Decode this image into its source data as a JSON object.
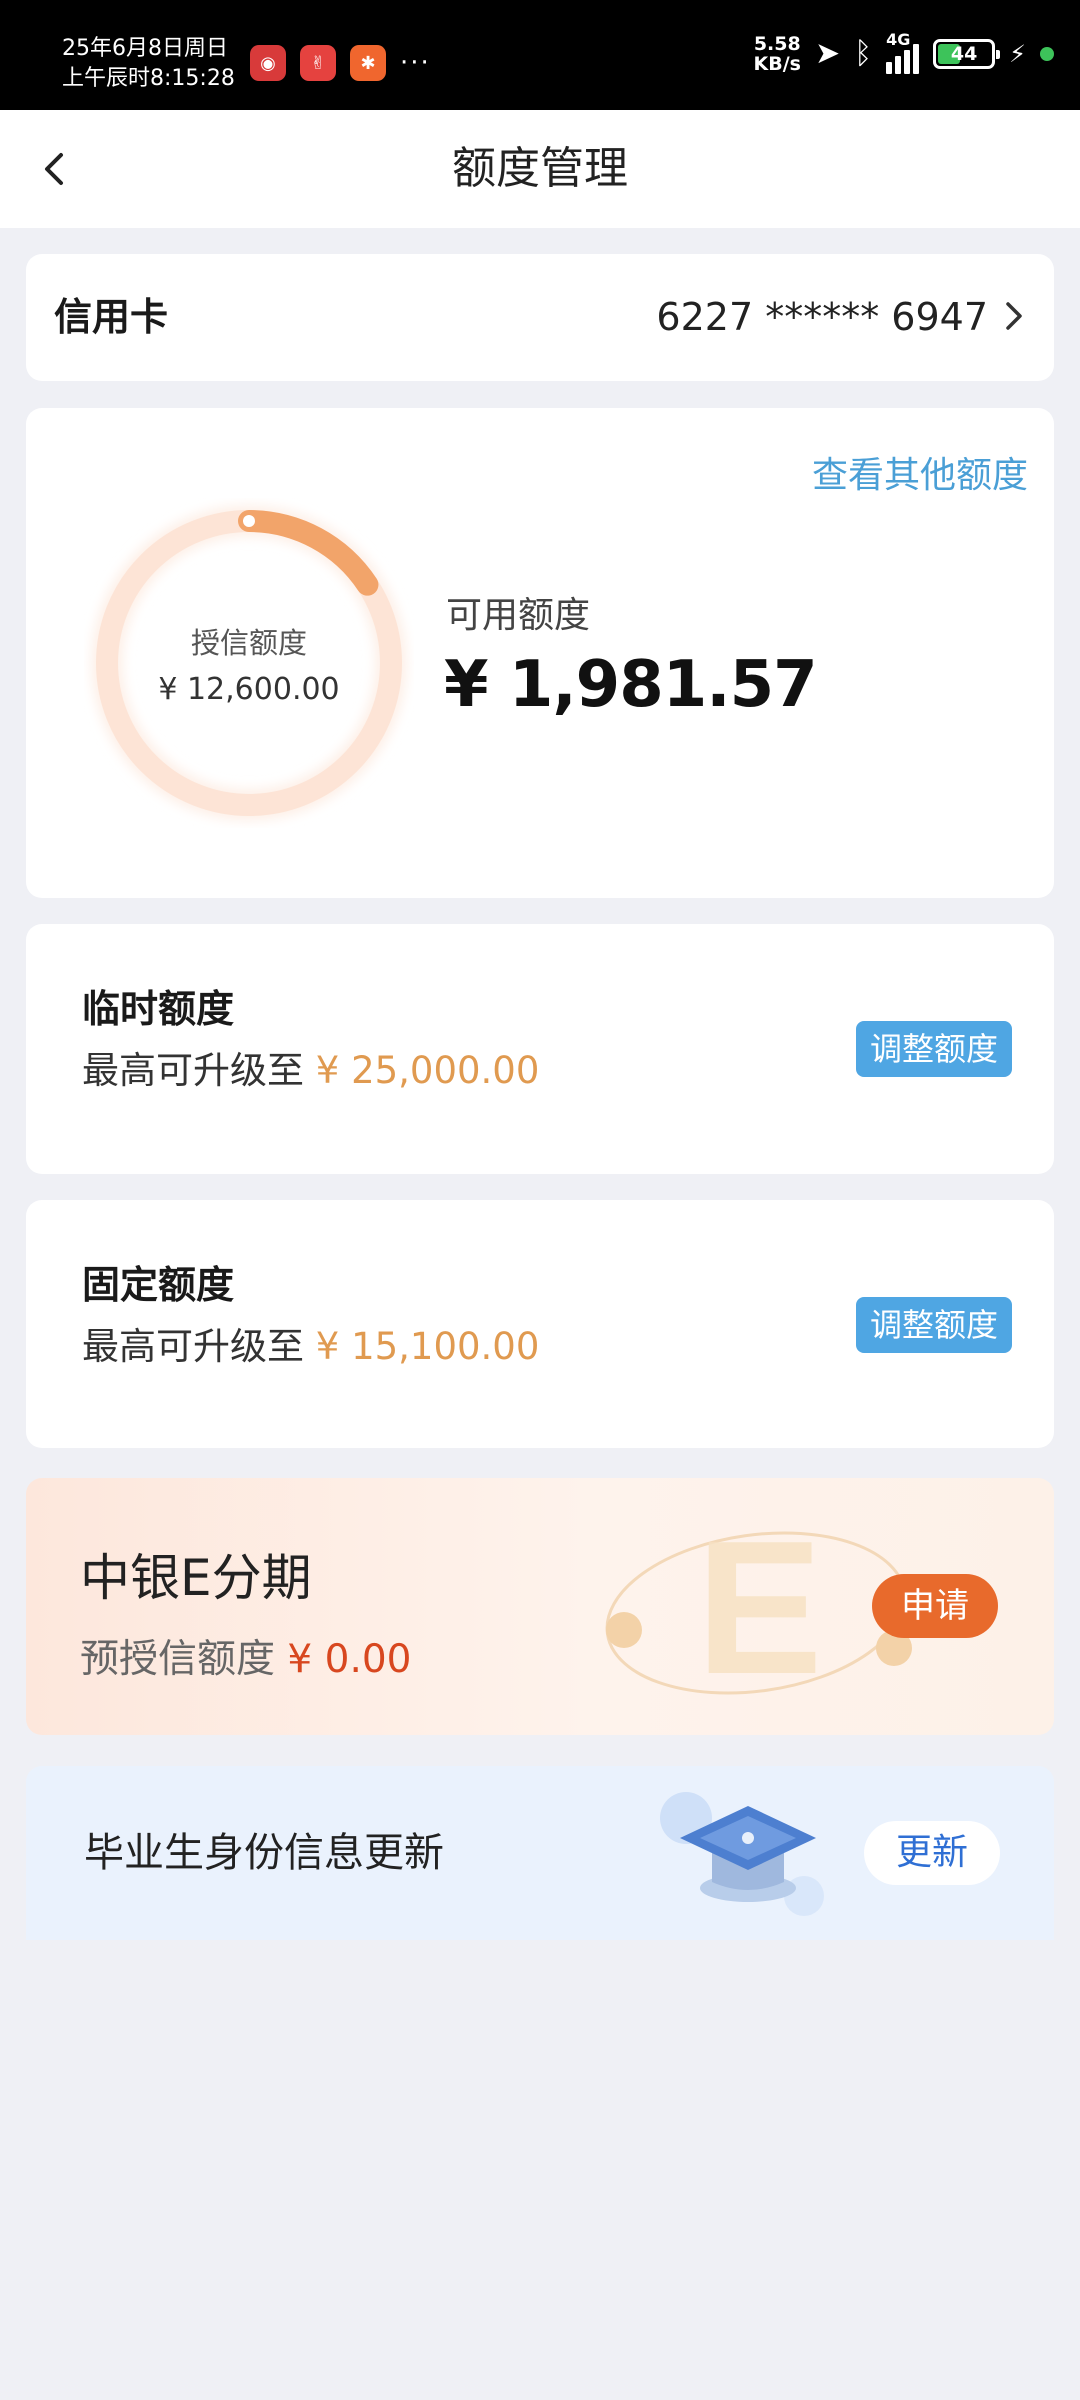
{
  "status_bar": {
    "date": "25年6月8日周日",
    "time": "上午辰时8:15:28",
    "more": "···",
    "speed_value": "5.58",
    "speed_unit": "KB/s",
    "network": "4G",
    "battery_level": "44",
    "battery_fraction": 0.44
  },
  "header": {
    "title": "额度管理"
  },
  "card_select": {
    "label": "信用卡",
    "card_number": "6227 ****** 6947"
  },
  "quota": {
    "other_link": "查看其他额度",
    "credit_label": "授信额度",
    "credit_value": "¥ 12,600.00",
    "available_label": "可用额度",
    "available_value": "¥ 1,981.57",
    "available_fraction": 0.157,
    "colors": {
      "ring_track": "#fde4d6",
      "ring_progress": "#f2a46a"
    }
  },
  "temporary_limit": {
    "title": "临时额度",
    "prefix": "最高可升级至",
    "amount": "¥ 25,000.00",
    "button": "调整额度"
  },
  "fixed_limit": {
    "title": "固定额度",
    "prefix": "最高可升级至",
    "amount": "¥ 15,100.00",
    "button": "调整额度"
  },
  "e_installment": {
    "title": "中银E分期",
    "prefix": "预授信额度",
    "amount": "¥ 0.00",
    "button": "申请"
  },
  "graduate": {
    "title": "毕业生身份信息更新",
    "button": "更新"
  },
  "colors": {
    "accent_blue": "#4fa6e3",
    "amount_orange": "#e09a50",
    "apply_orange": "#e86a2c",
    "update_blue": "#2f6fd4"
  }
}
